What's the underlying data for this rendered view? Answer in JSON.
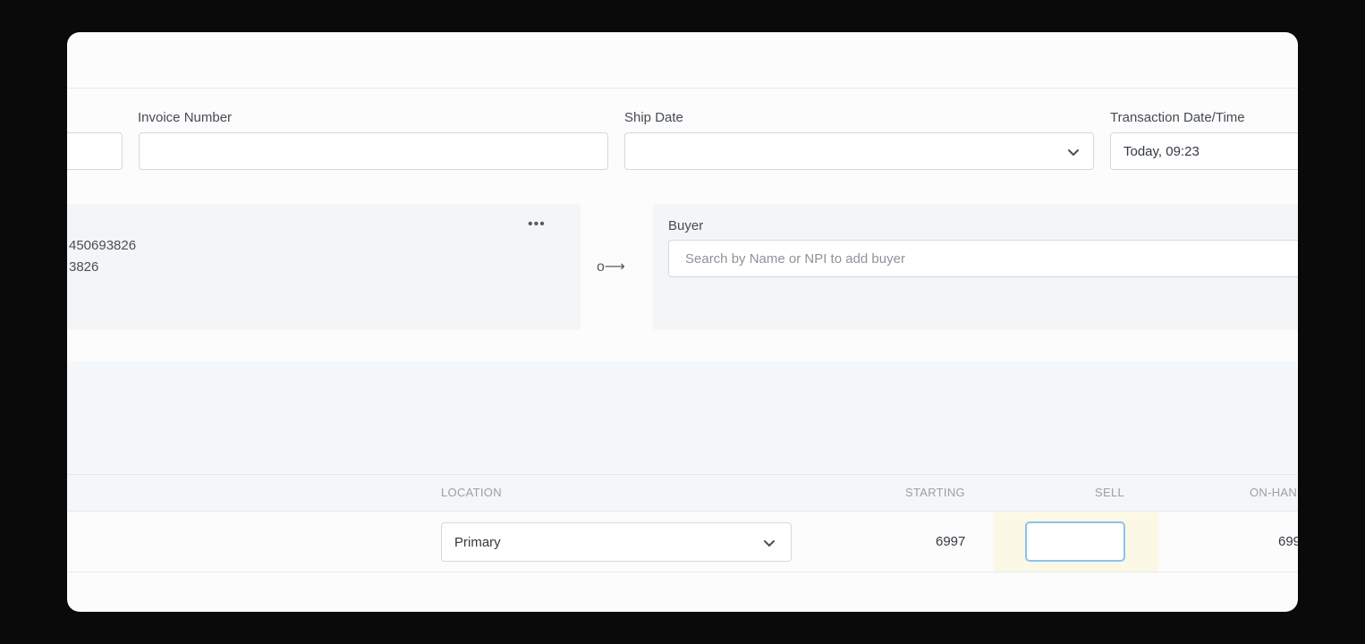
{
  "header": {
    "fields": {
      "invoice_number": {
        "label": "Invoice Number",
        "value": ""
      },
      "ship_date": {
        "label": "Ship Date",
        "value": ""
      },
      "transaction_datetime": {
        "label": "Transaction Date/Time",
        "value": "Today, 09:23"
      }
    }
  },
  "seller_card": {
    "line1": "450693826",
    "line2": "3826",
    "more_label": "•••"
  },
  "connector_label": "o⟶",
  "buyer_card": {
    "label": "Buyer",
    "search_placeholder": "Search by Name or NPI to add buyer"
  },
  "table": {
    "columns": {
      "location": "LOCATION",
      "starting": "STARTING",
      "sell": "SELL",
      "on_hand": "ON-HAN"
    },
    "row": {
      "location": "Primary",
      "starting": "6997",
      "sell": "",
      "on_hand": "699"
    }
  },
  "colors": {
    "focus_border": "#8cc3ec",
    "sell_highlight": "#fbf8e6"
  }
}
